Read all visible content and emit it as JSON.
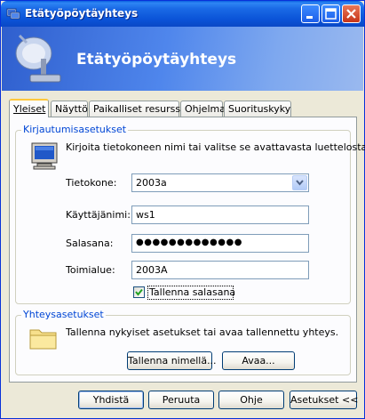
{
  "window": {
    "title": "Etätyöpöytäyhteys",
    "banner_title": "Etätyöpöytäyhteys"
  },
  "tabs": [
    {
      "label": "Yleiset",
      "active": true
    },
    {
      "label": "Näyttö",
      "active": false
    },
    {
      "label": "Paikalliset resurssit",
      "active": false
    },
    {
      "label": "Ohjelma",
      "active": false
    },
    {
      "label": "Suorituskyky",
      "active": false
    }
  ],
  "login": {
    "legend": "Kirjautumisasetukset",
    "instruction": "Kirjoita tietokoneen nimi tai valitse se avattavasta luettelosta.",
    "computer_label": "Tietokone:",
    "computer_value": "2003a",
    "username_label": "Käyttäjänimi:",
    "username_value": "ws1",
    "password_label": "Salasana:",
    "password_value": "●●●●●●●●●●●●●",
    "domain_label": "Toimialue:",
    "domain_value": "2003A",
    "save_password_label": "Tallenna salasana",
    "save_password_checked": true
  },
  "connection": {
    "legend": "Yhteysasetukset",
    "instruction": "Tallenna nykyiset asetukset tai avaa tallennettu yhteys.",
    "save_as_label": "Tallenna nimellä...",
    "open_label": "Avaa..."
  },
  "footer": {
    "connect_label": "Yhdistä",
    "cancel_label": "Peruuta",
    "help_label": "Ohje",
    "options_label": "Asetukset <<"
  },
  "colors": {
    "titlebar": "#0a54d8",
    "group_legend": "#0046d5",
    "active_tab_accent": "#ffc83c",
    "window_bg": "#ece9d8"
  },
  "icons": [
    "rdp-app-icon",
    "minimize-icon",
    "maximize-icon",
    "close-icon",
    "monitor-icon",
    "folder-icon",
    "chevron-down-icon",
    "checkmark-icon"
  ]
}
